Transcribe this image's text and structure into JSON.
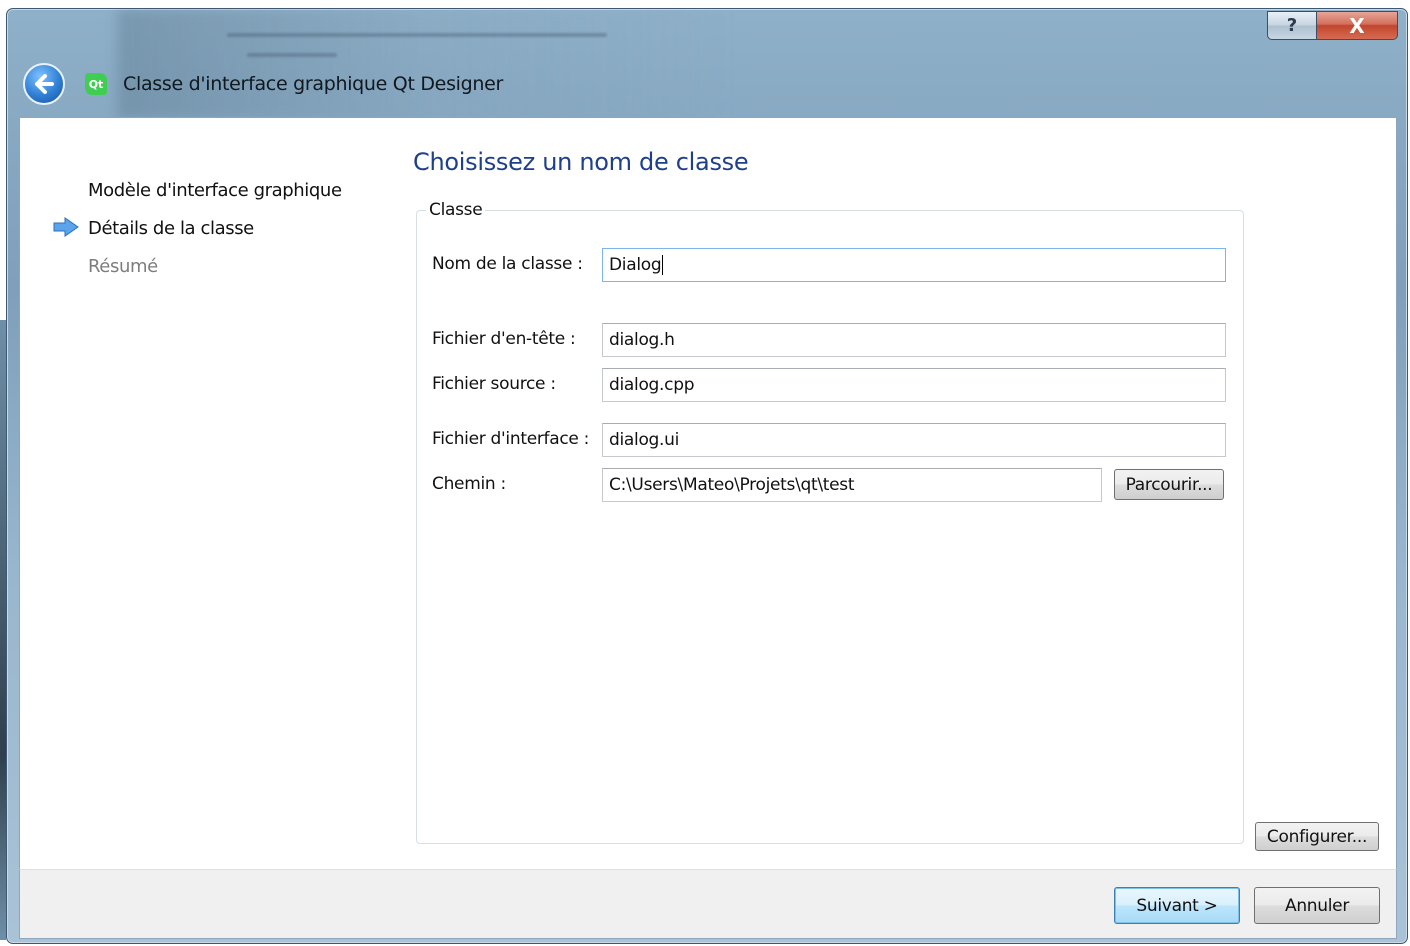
{
  "window": {
    "title": "Classe d'interface graphique Qt Designer",
    "help_glyph": "?",
    "close_glyph": "X",
    "app_icon": "qt-icon",
    "app_icon_text": "Qt"
  },
  "steps": [
    {
      "label": "Modèle d'interface graphique",
      "state": "done"
    },
    {
      "label": "Détails de la classe",
      "state": "current"
    },
    {
      "label": "Résumé",
      "state": "pending"
    }
  ],
  "page": {
    "title": "Choisissez un nom de classe",
    "group_title": "Classe"
  },
  "fields": {
    "class_name": {
      "label": "Nom de la classe :",
      "value": "Dialog"
    },
    "header_file": {
      "label": "Fichier d'en-tête :",
      "value": "dialog.h"
    },
    "source_file": {
      "label": "Fichier source :",
      "value": "dialog.cpp"
    },
    "form_file": {
      "label": "Fichier d'interface :",
      "value": "dialog.ui"
    },
    "path": {
      "label": "Chemin :",
      "value": "C:\\Users\\Mateo\\Projets\\qt\\test"
    }
  },
  "buttons": {
    "browse": "Parcourir...",
    "configure": "Configurer...",
    "next": "Suivant >",
    "cancel": "Annuler"
  },
  "colors": {
    "page_title": "#1e3f8a",
    "accent_arrow": "#3a8ee6"
  }
}
